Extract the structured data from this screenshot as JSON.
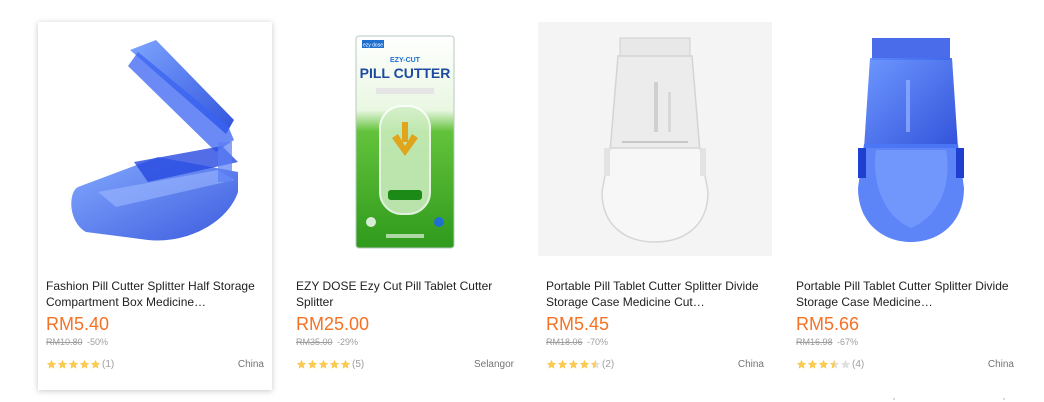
{
  "accent_color": "#f57224",
  "star_color": "#faca51",
  "products": [
    {
      "image_icon": "blue-pill-cutter-open-image",
      "title": "Fashion Pill Cutter Splitter Half Storage Compartment Box Medicine…",
      "price": "RM5.40",
      "original_price": "RM10.80",
      "discount": "-50%",
      "rating": 5,
      "review_count": "(1)",
      "location": "China"
    },
    {
      "image_icon": "ezy-cut-pill-cutter-package-image",
      "package_brand": "ezy dose",
      "package_small": "EZY-CUT",
      "package_title": "PILL CUTTER",
      "title": "EZY DOSE Ezy Cut Pill Tablet Cutter Splitter",
      "price": "RM25.00",
      "original_price": "RM35.00",
      "discount": "-29%",
      "rating": 5,
      "review_count": "(5)",
      "location": "Selangor"
    },
    {
      "image_icon": "clear-pill-cutter-image",
      "title": "Portable Pill Tablet Cutter Splitter Divide Storage Case Medicine Cut…",
      "price": "RM5.45",
      "original_price": "RM18.06",
      "discount": "-70%",
      "rating": 4.5,
      "review_count": "(2)",
      "location": "China"
    },
    {
      "image_icon": "blue-pill-cutter-closed-image",
      "title": "Portable Pill Tablet Cutter Splitter Divide Storage Case Medicine…",
      "price": "RM5.66",
      "original_price": "RM16.98",
      "discount": "-67%",
      "rating": 3.5,
      "review_count": "(4)",
      "location": "China"
    }
  ]
}
